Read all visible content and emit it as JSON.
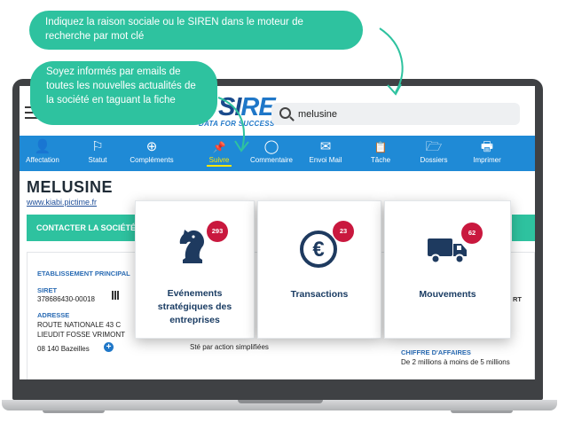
{
  "tooltips": {
    "search_hint": "Indiquez la raison sociale ou le SIREN dans le moteur de recherche par mot clé",
    "follow_hint": "Soyez informés par emails de toutes les nouvelles actualités de la société en taguant la fiche"
  },
  "header": {
    "logo_main": "SI",
    "logo_accent": "RE",
    "logo_tagline": "DATA FOR SUCCESS",
    "search_value": "melusine"
  },
  "toolbar": [
    {
      "label": "Affectation",
      "icon": "person-icon",
      "glyph": "👤"
    },
    {
      "label": "Statut",
      "icon": "flag-icon",
      "glyph": "⚐"
    },
    {
      "label": "Compléments",
      "icon": "plus-circle-icon",
      "glyph": "⊕"
    },
    {
      "label": "Suivre",
      "icon": "pin-icon",
      "glyph": "📌"
    },
    {
      "label": "Commentaire",
      "icon": "comment-icon",
      "glyph": "◯"
    },
    {
      "label": "Envoi Mail",
      "icon": "mail-icon",
      "glyph": "✉"
    },
    {
      "label": "Tâche",
      "icon": "clipboard-icon",
      "glyph": "📋"
    },
    {
      "label": "Dossiers",
      "icon": "folder-icon",
      "glyph": "🗁"
    },
    {
      "label": "Imprimer",
      "icon": "printer-icon",
      "glyph": "🖶"
    }
  ],
  "company": {
    "name": "MELUSINE",
    "url": "www.kiabi.pictime.fr",
    "contact_label": "CONTACTER LA SOCIÉTÉ",
    "establishment_label": "ETABLISSEMENT PRINCIPAL",
    "siret_label": "SIRET",
    "siret_value": "378686430-00018",
    "address_label": "ADRESSE",
    "address_line1": "ROUTE NATIONALE 43 C",
    "address_line2": "LIEUDIT FOSSE VRIMONT",
    "address_line3": "08 140 Bazeilles",
    "legal_form_fragment": "Sté par action simplifiées",
    "ca_label": "CHIFFRE D'AFFAIRES",
    "ca_value": "De 2 millions à moins de 5 millions",
    "right_fragment": "RT"
  },
  "cards": [
    {
      "title_lines": [
        "Evénements",
        "stratégiques des",
        "entreprises"
      ],
      "badge": "293",
      "icon": "chess-knight-icon"
    },
    {
      "title_lines": [
        "Transactions"
      ],
      "badge": "23",
      "icon": "euro-icon"
    },
    {
      "title_lines": [
        "Mouvements"
      ],
      "badge": "62",
      "icon": "truck-icon"
    }
  ],
  "colors": {
    "accent_green": "#2ec29f",
    "toolbar_blue": "#1f8ad6",
    "badge_red": "#c9183e",
    "active_yellow": "#ffe600"
  }
}
